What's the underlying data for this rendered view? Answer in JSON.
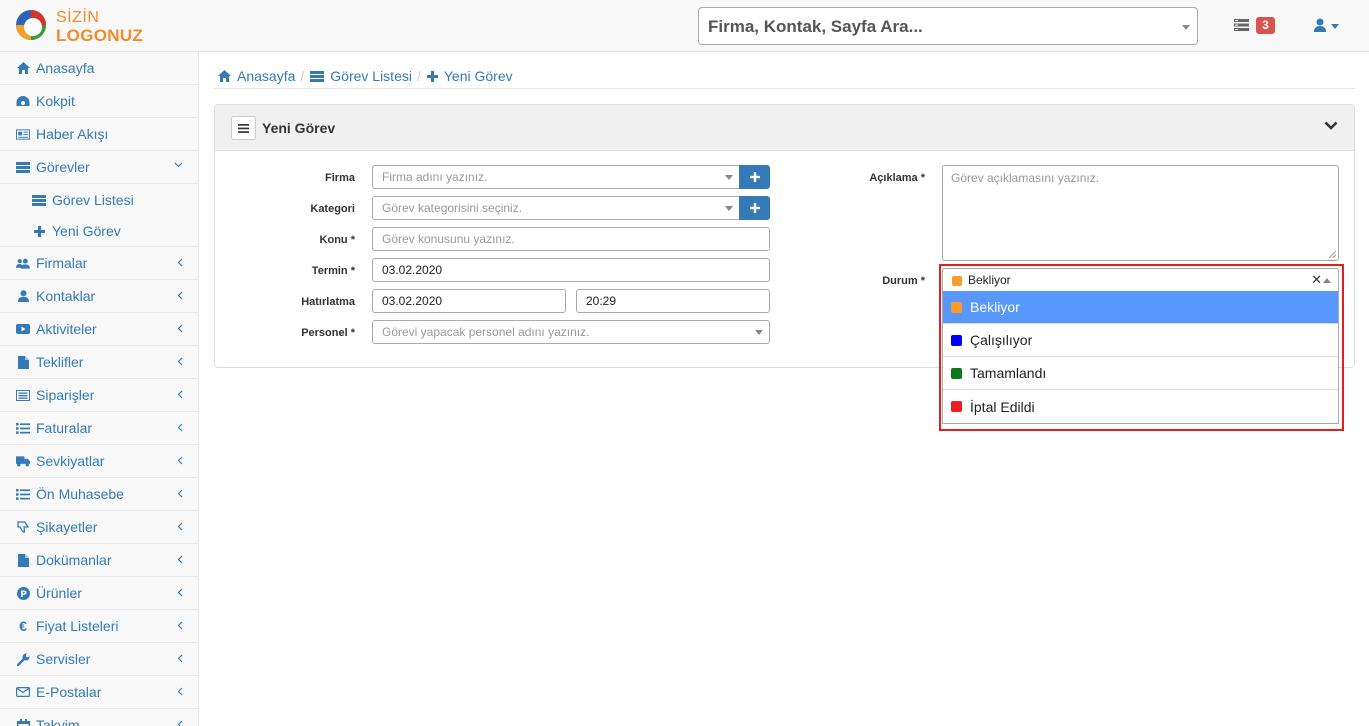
{
  "logo": {
    "line1": "SİZİN",
    "line2": "LOGONUZ"
  },
  "search": {
    "placeholder": "Firma, Kontak, Sayfa Ara..."
  },
  "header": {
    "task_count": "3"
  },
  "sidebar": {
    "items": [
      {
        "label": "Anasayfa",
        "icon": "home-icon"
      },
      {
        "label": "Kokpit",
        "icon": "dashboard-icon"
      },
      {
        "label": "Haber Akışı",
        "icon": "newspaper-icon"
      },
      {
        "label": "Görevler",
        "icon": "tasks-icon",
        "expanded": true
      },
      {
        "label": "Firmalar",
        "icon": "users-icon"
      },
      {
        "label": "Kontaklar",
        "icon": "user-icon"
      },
      {
        "label": "Aktiviteler",
        "icon": "video-icon"
      },
      {
        "label": "Teklifler",
        "icon": "file-icon"
      },
      {
        "label": "Siparişler",
        "icon": "list-alt-icon"
      },
      {
        "label": "Faturalar",
        "icon": "list-icon"
      },
      {
        "label": "Sevkiyatlar",
        "icon": "truck-icon"
      },
      {
        "label": "Ön Muhasebe",
        "icon": "list-ul-icon"
      },
      {
        "label": "Şikayetler",
        "icon": "thumbs-down-icon"
      },
      {
        "label": "Dokümanlar",
        "icon": "document-icon"
      },
      {
        "label": "Ürünler",
        "icon": "product-icon"
      },
      {
        "label": "Fiyat Listeleri",
        "icon": "euro-icon"
      },
      {
        "label": "Servisler",
        "icon": "wrench-icon"
      },
      {
        "label": "E-Postalar",
        "icon": "envelope-icon"
      },
      {
        "label": "Takvim",
        "icon": "calendar-icon"
      }
    ],
    "sub_items": [
      {
        "label": "Görev Listesi",
        "icon": "tasks-icon"
      },
      {
        "label": "Yeni Görev",
        "icon": "plus-icon"
      }
    ]
  },
  "breadcrumb": [
    {
      "label": "Anasayfa",
      "icon": "home-icon"
    },
    {
      "label": "Görev Listesi",
      "icon": "tasks-icon"
    },
    {
      "label": "Yeni Görev",
      "icon": "plus-icon"
    }
  ],
  "panel": {
    "title": "Yeni Görev"
  },
  "form": {
    "firma": {
      "label": "Firma",
      "placeholder": "Firma adını yazınız."
    },
    "kategori": {
      "label": "Kategori",
      "placeholder": "Görev kategorisini seçiniz."
    },
    "konu": {
      "label": "Konu *",
      "placeholder": "Görev konusunu yazınız."
    },
    "termin": {
      "label": "Termin *",
      "value": "03.02.2020"
    },
    "hatirlatma": {
      "label": "Hatırlatma",
      "date": "03.02.2020",
      "time": "20:29"
    },
    "personel": {
      "label": "Personel *",
      "placeholder": "Görevi yapacak personel adını yazınız."
    },
    "aciklama": {
      "label": "Açıklama *",
      "placeholder": "Görev açıklamasını yazınız."
    },
    "durum": {
      "label": "Durum *",
      "selected": "Bekliyor",
      "selected_color": "#f89c2c",
      "options": [
        {
          "label": "Bekliyor",
          "color": "#f89c2c",
          "active": true
        },
        {
          "label": "Çalışılıyor",
          "color": "#0000ff",
          "active": false
        },
        {
          "label": "Tamamlandı",
          "color": "#0b7a1a",
          "active": false
        },
        {
          "label": "İptal Edildi",
          "color": "#ef1c24",
          "active": false
        }
      ]
    }
  }
}
